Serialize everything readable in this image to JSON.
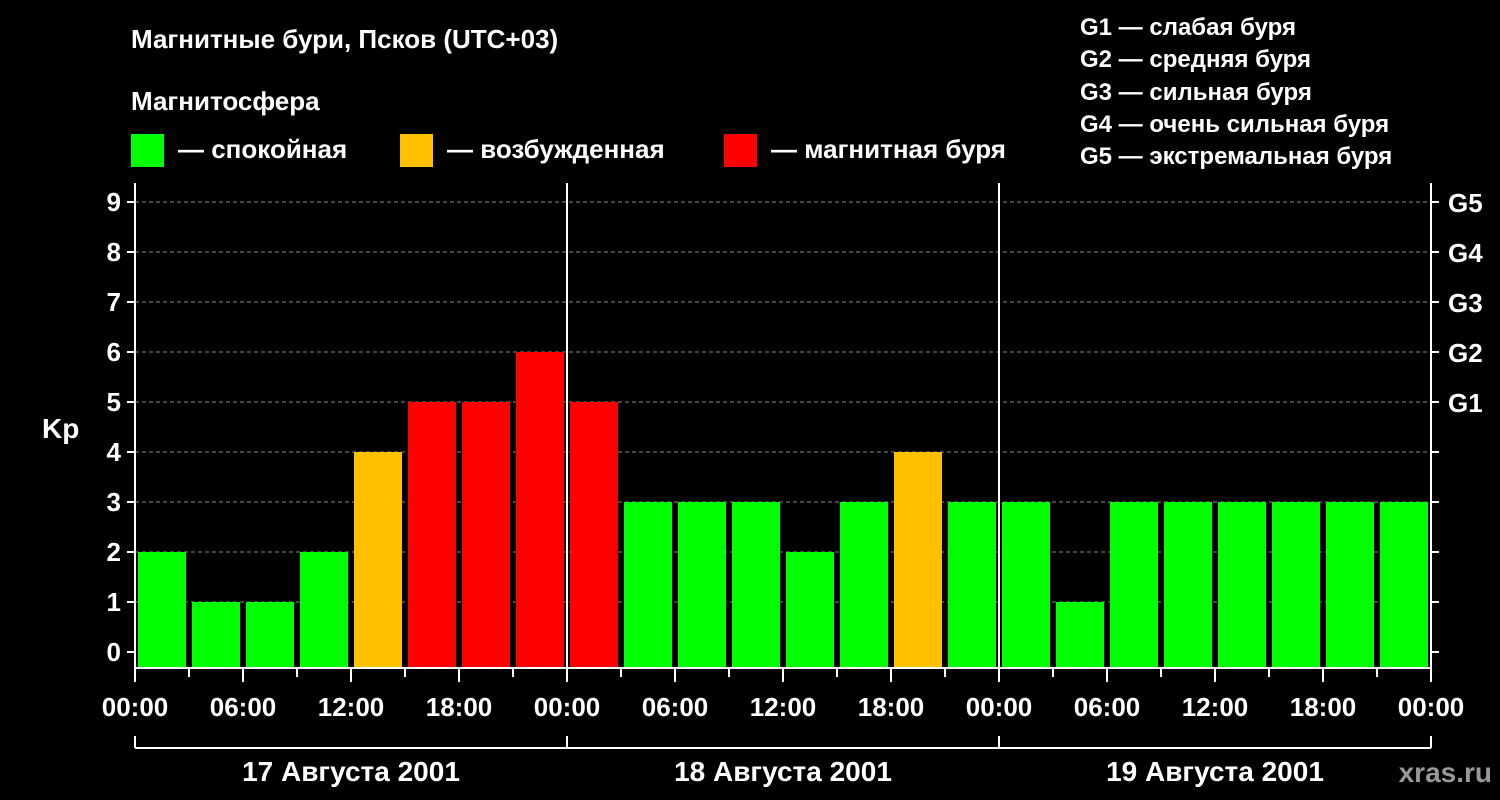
{
  "title": "Магнитные бури, Псков (UTC+03)",
  "magnetosphere_label": "Магнитосфера",
  "legend": [
    {
      "label": "— спокойная",
      "color": "#00ff00"
    },
    {
      "label": "— возбужденная",
      "color": "#ffc000"
    },
    {
      "label": "— магнитная буря",
      "color": "#ff0000"
    }
  ],
  "g_scale": [
    "G1 — слабая буря",
    "G2 — средняя буря",
    "G3 — сильная буря",
    "G4 — очень сильная буря",
    "G5 — экстремальная буря"
  ],
  "watermark": "xras.ru",
  "chart_data": {
    "type": "bar",
    "ylabel": "Kp",
    "ylim": [
      0,
      9
    ],
    "y_ticks": [
      "0",
      "1",
      "2",
      "3",
      "4",
      "5",
      "6",
      "7",
      "8",
      "9"
    ],
    "right_ticks": [
      {
        "kp": 5,
        "label": "G1"
      },
      {
        "kp": 6,
        "label": "G2"
      },
      {
        "kp": 7,
        "label": "G3"
      },
      {
        "kp": 8,
        "label": "G4"
      },
      {
        "kp": 9,
        "label": "G5"
      }
    ],
    "x_tick_labels": [
      "00:00",
      "06:00",
      "12:00",
      "18:00",
      "00:00",
      "06:00",
      "12:00",
      "18:00",
      "00:00",
      "06:00",
      "12:00",
      "18:00",
      "00:00"
    ],
    "days": [
      "17 Августа 2001",
      "18 Августа 2001",
      "19 Августа 2001"
    ],
    "interval_hours": 3,
    "values": [
      2,
      1,
      1,
      2,
      4,
      5,
      5,
      6,
      5,
      3,
      3,
      3,
      2,
      3,
      4,
      3,
      3,
      1,
      3,
      3,
      3,
      3,
      3,
      3
    ],
    "categories": [
      "спокойная",
      "возбужденная",
      "магнитная буря"
    ],
    "category_colors": [
      "#00ff00",
      "#ffc000",
      "#ff0000"
    ],
    "bar_category": [
      0,
      0,
      0,
      0,
      1,
      2,
      2,
      2,
      2,
      0,
      0,
      0,
      0,
      0,
      1,
      0,
      0,
      0,
      0,
      0,
      0,
      0,
      0,
      0
    ],
    "grid_major_color": "#ffffff",
    "grid_minor_color": "#888888"
  }
}
